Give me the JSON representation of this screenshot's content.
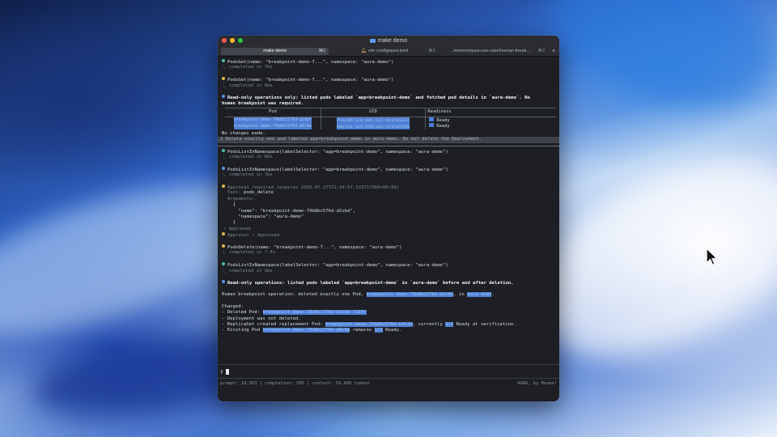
{
  "window": {
    "title": "make demo",
    "tabs": [
      {
        "label": "make demo",
        "shortcut": "⌘1",
        "active": true
      },
      {
        "label": "vim config/aura.toml",
        "shortcut": "⌘2",
        "active": false
      },
      {
        "label": "…/mezmo/aura-use-case/human-break…",
        "shortcut": "⌘3",
        "active": false
      }
    ],
    "new_tab": "+"
  },
  "colors": {
    "dot_teal": "#4fb6a8",
    "dot_yellow": "#e0b64c",
    "dot_blue": "#5a8ee0",
    "selection": "#4d7fd6",
    "terminal_bg": "#1d1f24"
  },
  "log": {
    "e1_call": "PodsGet(name: \"breakpoint-demo-7...\", namespace: \"aura-demo\")",
    "e1_status": "⎿ completed in 7ms",
    "e2_call": "PodsGet(name: \"breakpoint-demo-7...\", namespace: \"aura-demo\")",
    "e2_status": "⎿ completed in 6ms",
    "e3_text1": "Read-only operations only: listed pods labeled `app=breakpoint-demo` and fetched pod details in `aura-demo`. No",
    "e3_text2": "human breakpoint was required.",
    "table_headers": [
      "Pod",
      "UID",
      "Readiness"
    ],
    "table_rows": [
      {
        "pod": "breakpoint-demo-79b8bc576d-gzdpf",
        "uid": "4f1a2e8b-5c3d-4a91-9e27-b8c6f0d2a317",
        "ready": "Ready"
      },
      {
        "pod": "breakpoint-demo-79b8bc576d-p6c9w",
        "uid": "9d0c7b41-3e25-4f68-a1b3-5e7d2c8f4906",
        "ready": "Ready"
      }
    ],
    "no_changes": "No changes made.",
    "user_prompt": "❯ Delete exactly one pod labeled app=breakpoint-demo in aura-demo. Do not delete the Deployment.",
    "e4_call": "PodsListInNamespace(labelSelector: \"app=breakpoint-demo\", namespace: \"aura-demo\")",
    "e4_status": "⎿ completed in 8ms",
    "e5_call": "PodsListInNamespace(labelSelector: \"app=breakpoint-demo\", namespace: \"aura-demo\")",
    "e5_status": "⎿ completed in 7ms",
    "approval_required": "Approval required",
    "approval_expires": "(expires 2026-07-27T21:14:57.133717969+00:00)",
    "approval_tool_label": "Tool:",
    "approval_tool": "pods_delete",
    "approval_args_label": "Arguments:",
    "approval_args": [
      "  {",
      "    \"name\": \"breakpoint-demo-79b8bc576d-d2skd\",",
      "    \"namespace\": \"aura-demo\"",
      "  }"
    ],
    "approved_check": "✓ Approved",
    "approval_result": "Approval ✓ Approved",
    "e6_call": "PodsDelete(name: \"breakpoint-demo-7...\", namespace: \"aura-demo\")",
    "e6_status": "⎿ completed in 7.4s",
    "e7_call": "PodsListInNamespace(labelSelector: \"app=breakpoint-demo\", namespace: \"aura-demo\")",
    "e7_status": "⎿ completed in 9ms",
    "summary_title": "Read-only operations: listed pods labeled `app=breakpoint-demo` in `aura-demo` before and after deletion.",
    "summary_op_pre": "Human breakpoint operation: deleted exactly one Pod,",
    "summary_op_pod": "breakpoint-demo-79b8bc576d-d2skd",
    "summary_op_mid": ", in",
    "summary_op_ns": "aura-demo",
    "summary_op_end": ".",
    "changed_label": "Changed:",
    "ch1_pre": "- Deleted Pod:",
    "ch1_sel": "breakpoint-demo-79b8bc576d-d2skd (UID)",
    "ch2": "- Deployment was not deleted.",
    "ch3_pre": "- ReplicaSet created replacement Pod:",
    "ch3_sel": "breakpoint-demo-79b8bc576d-k4t2m",
    "ch3_mid": ", currently",
    "ch3_sel2": "1/1",
    "ch3_end": "Ready at verification.",
    "ch4_pre": "- Existing Pod",
    "ch4_sel": "breakpoint-demo-79b8bc576d-p6c9w",
    "ch4_mid": "remains",
    "ch4_sel2": "1/1",
    "ch4_end": "Ready."
  },
  "prompt": {
    "symbol": "❯",
    "value": ""
  },
  "status": {
    "left": "prompt: 18,983 | completion: 505 | context: 19,488 tokens",
    "right": "AURA, by Mezmo!"
  }
}
